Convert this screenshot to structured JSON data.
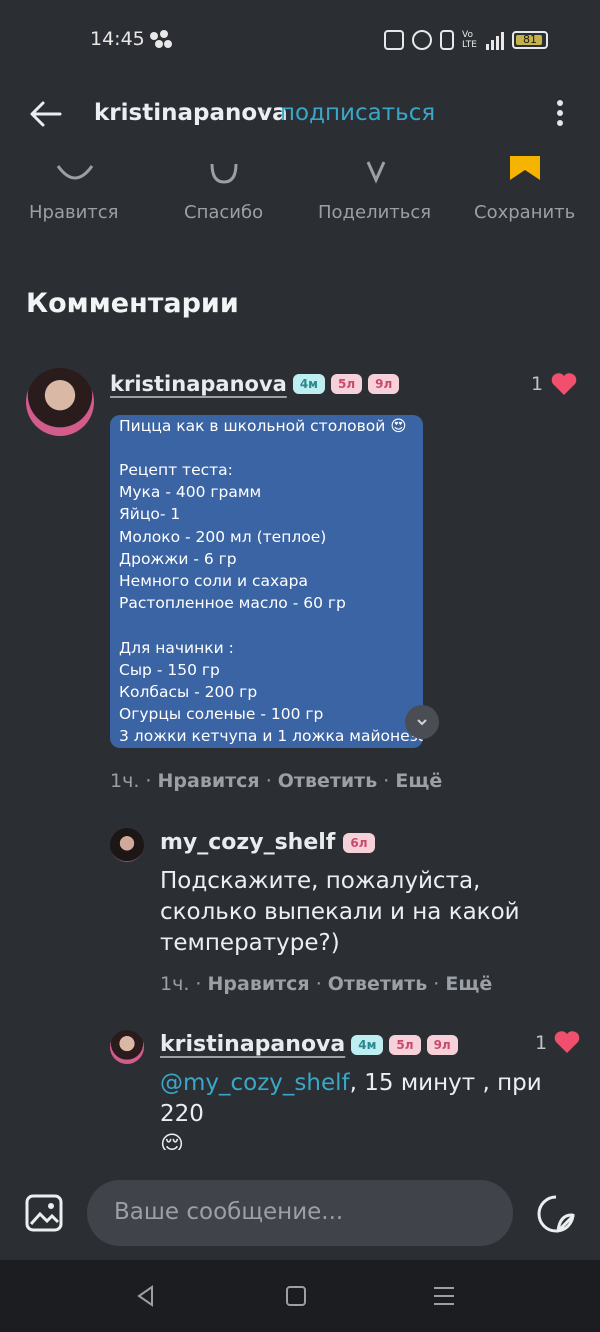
{
  "status_bar": {
    "time": "14:45",
    "battery": "81"
  },
  "header": {
    "username": "kristinapanova",
    "separator": "·",
    "subscribe": "подписаться"
  },
  "actions": [
    {
      "label": "Нравится",
      "icon": "heart-outline-icon"
    },
    {
      "label": "Спасибо",
      "icon": "thanks-icon"
    },
    {
      "label": "Поделиться",
      "icon": "share-icon"
    },
    {
      "label": "Сохранить",
      "icon": "bookmark-icon"
    }
  ],
  "comments_title": "Комментарии",
  "comments": [
    {
      "user": "kristinapanova",
      "badges": [
        "4м",
        "5л",
        "9л"
      ],
      "likes": "1",
      "recipe_lines": [
        "Пицца как в школьной столовой 😍",
        "",
        "Рецепт теста:",
        "Мука - 400 грамм",
        "Яйцо- 1",
        "Молоко - 200 мл (теплое)",
        "Дрожжи - 6 гр",
        "Немного соли и сахара",
        "Растопленное масло - 60 гр",
        "",
        "Для начинки :",
        "Сыр - 150 гр",
        "Колбасы - 200 гр",
        "Огурцы соленые - 100 гр",
        "3 ложки кетчупа и 1 ложка майонеза"
      ],
      "meta": {
        "time": "1ч.",
        "like": "Нравится",
        "reply": "Ответить",
        "more": "Ещё"
      }
    },
    {
      "user": "my_cozy_shelf",
      "badges": [
        "6л"
      ],
      "text_lines": [
        "Подскажите, пожалуйста,",
        "сколько выпекали и на какой",
        "температуре?)"
      ],
      "meta": {
        "time": "1ч.",
        "like": "Нравится",
        "reply": "Ответить",
        "more": "Ещё"
      }
    },
    {
      "user": "kristinapanova",
      "badges": [
        "4м",
        "5л",
        "9л"
      ],
      "likes": "1",
      "mention": "@my_cozy_shelf",
      "text_rest": ", 15 минут , при 220",
      "emoji": "😌"
    }
  ],
  "composer": {
    "placeholder": "Ваше сообщение..."
  },
  "colors": {
    "background": "#2b2e33",
    "accent": "#3aa7c8",
    "recipe_bg": "#3b64a4",
    "heart": "#f0506e"
  }
}
